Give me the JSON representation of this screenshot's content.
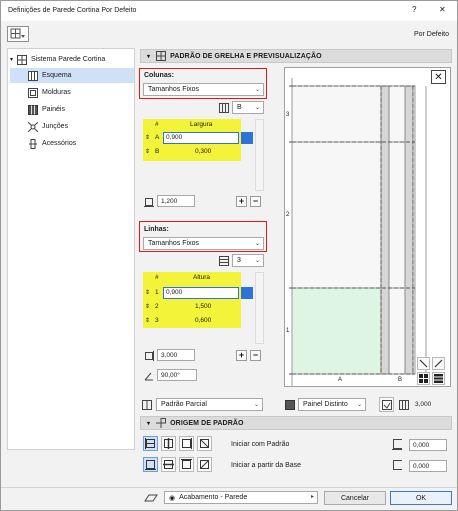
{
  "window": {
    "title": "Definições de Parede Cortina Por Defeito",
    "help": "?",
    "close": "✕"
  },
  "toolbar": {
    "default_label": "Por Defeito"
  },
  "tree": {
    "root": "Sistema Parede Cortina",
    "items": [
      "Esquema",
      "Molduras",
      "Painéis",
      "Junções",
      "Acessórios"
    ]
  },
  "grid_panel": {
    "title": "PADRÃO DE GRELHA E PREVISUALIZAÇÃO",
    "columns_label": "Colunas:",
    "columns_mode": "Tamanhos Fixos",
    "columns_select": "B",
    "columns_table": {
      "headers": [
        "#",
        "Largura"
      ],
      "rows": [
        {
          "id": "A",
          "value": "0,900"
        },
        {
          "id": "B",
          "value": "0,300"
        }
      ]
    },
    "columns_total": "1,200",
    "rows_label": "Linhas:",
    "rows_mode": "Tamanhos Fixos",
    "rows_select": "3",
    "rows_table": {
      "headers": [
        "#",
        "Altura"
      ],
      "rows": [
        {
          "id": "1",
          "value": "0,900"
        },
        {
          "id": "2",
          "value": "1,500"
        },
        {
          "id": "3",
          "value": "0,600"
        }
      ]
    },
    "rows_total": "3,000",
    "angle": "90,00°",
    "pattern_select": "Padrão Parcial",
    "panel_select": "Painel Distinto",
    "total_height": "3,000"
  },
  "preview": {
    "row_labels": [
      "3",
      "2",
      "1"
    ],
    "col_labels": [
      "A",
      "B"
    ]
  },
  "origin_panel": {
    "title": "ORIGEM DE PADRÃO",
    "start_label": "Iniciar com Padrão",
    "base_label": "Iniciar a partir da Base",
    "start_value": "0,000",
    "base_value": "0,000"
  },
  "footer": {
    "finish_select": "Acabamento - Parede",
    "cancel": "Cancelar",
    "ok": "OK"
  },
  "colors": {
    "highlight_yellow": "#f3f33a",
    "selection_blue": "#2e74d8",
    "callout_red": "#e01818",
    "panel_green": "#dff5e3"
  }
}
